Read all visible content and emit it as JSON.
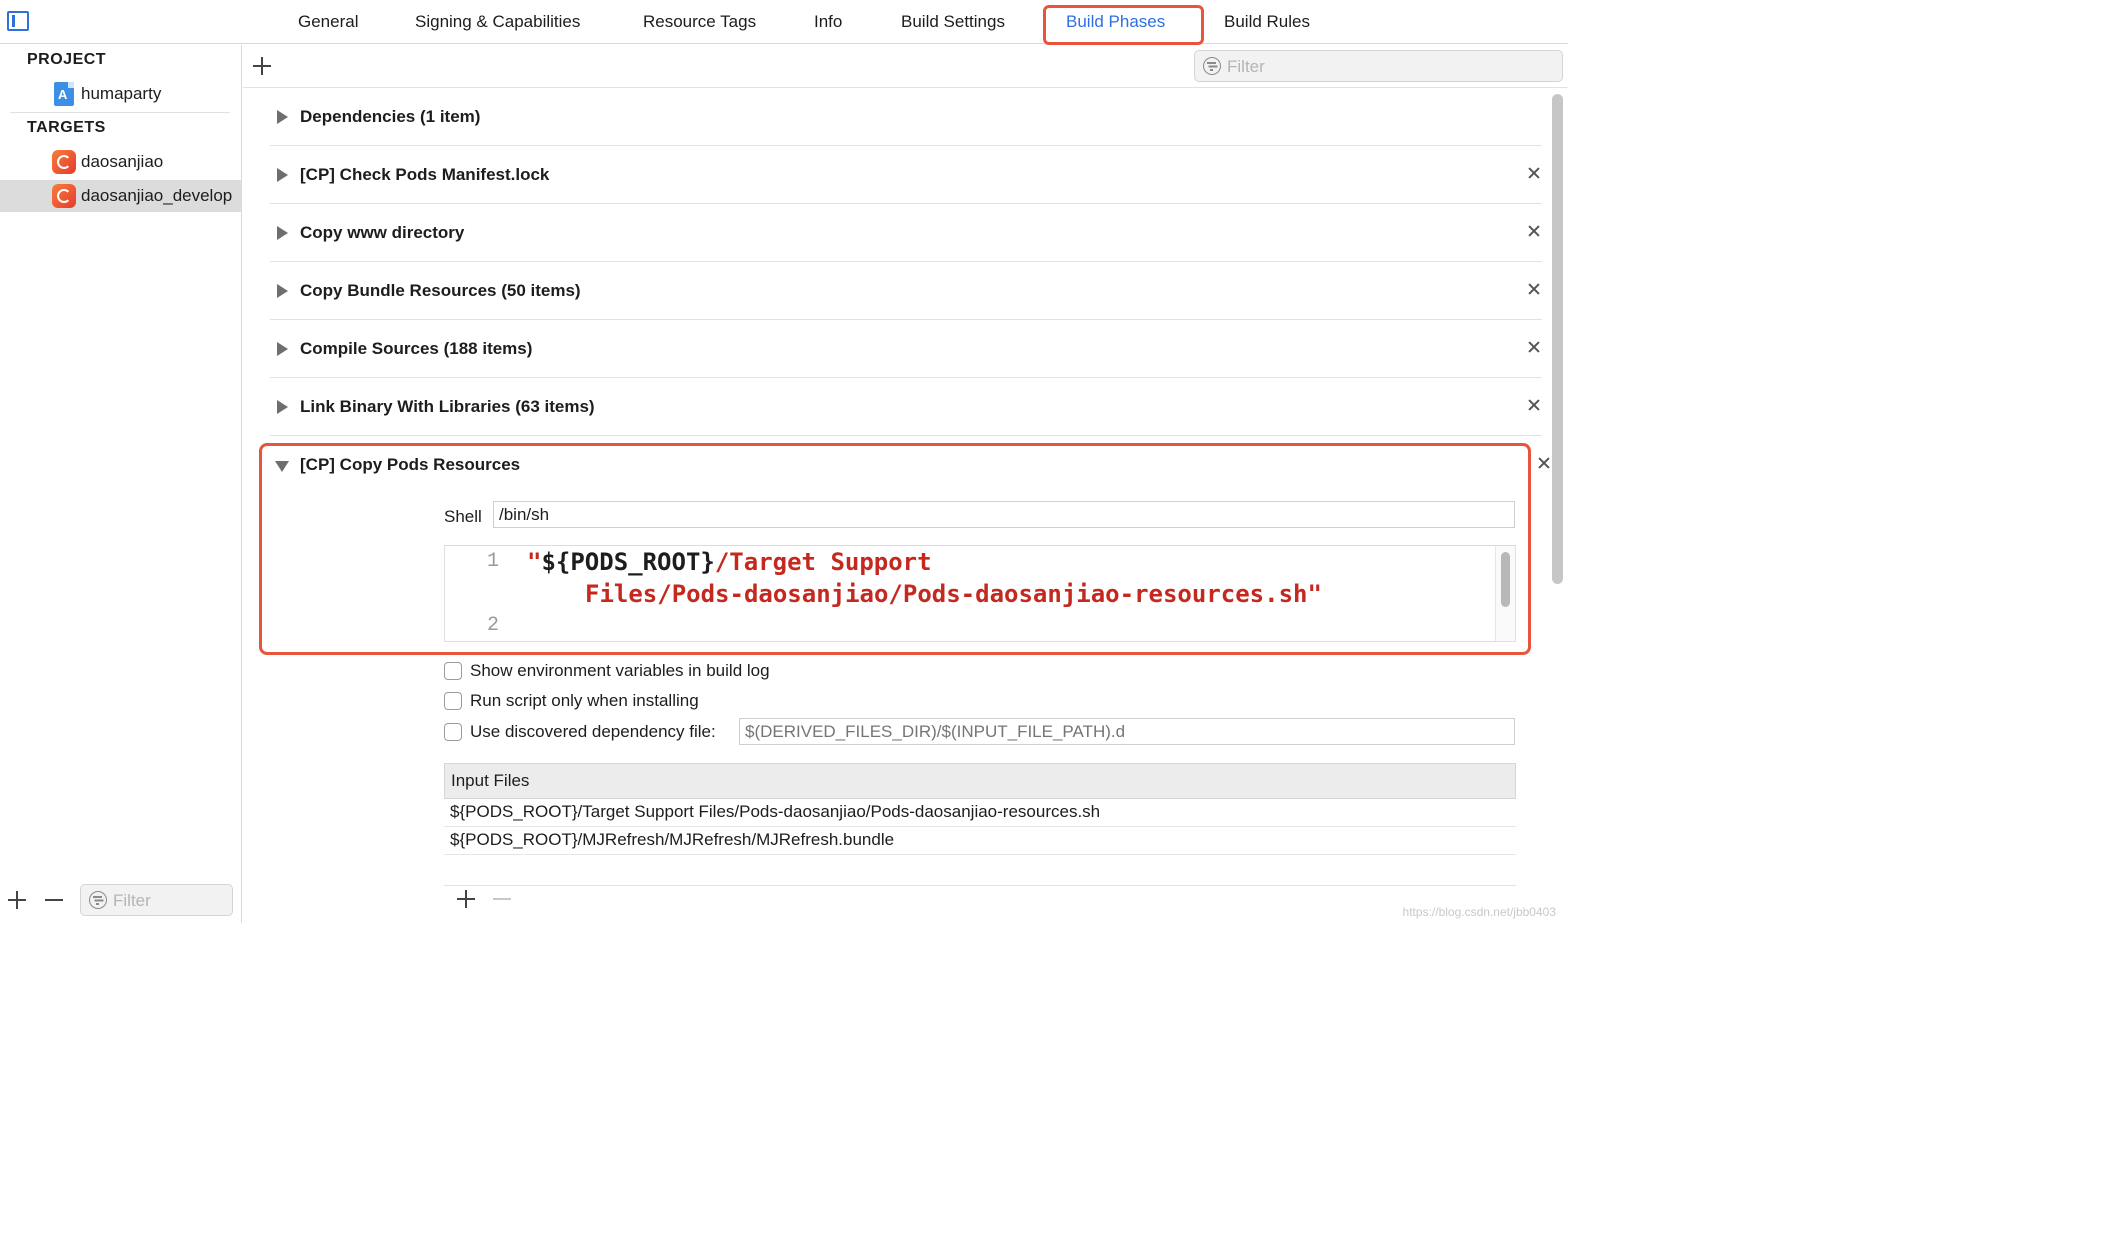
{
  "tabs": [
    {
      "label": "General"
    },
    {
      "label": "Signing & Capabilities"
    },
    {
      "label": "Resource Tags"
    },
    {
      "label": "Info"
    },
    {
      "label": "Build Settings"
    },
    {
      "label": "Build Phases",
      "active": true
    },
    {
      "label": "Build Rules"
    }
  ],
  "sidebar": {
    "project_header": "PROJECT",
    "project_item": "humaparty",
    "targets_header": "TARGETS",
    "targets": [
      {
        "label": "daosanjiao"
      },
      {
        "label": "daosanjiao_develop",
        "selected": true
      }
    ],
    "filter_placeholder": "Filter"
  },
  "toolbar": {
    "filter_placeholder": "Filter"
  },
  "phases": [
    {
      "title": "Dependencies (1 item)"
    },
    {
      "title": "[CP] Check Pods Manifest.lock"
    },
    {
      "title": "Copy www directory"
    },
    {
      "title": "Copy Bundle Resources (50 items)"
    },
    {
      "title": "Compile Sources (188 items)"
    },
    {
      "title": "Link Binary With Libraries (63 items)"
    },
    {
      "title": "[CP] Copy Pods Resources",
      "expanded": true
    }
  ],
  "script": {
    "shell_label": "Shell",
    "shell_value": "/bin/sh",
    "line_numbers": [
      "1",
      "2"
    ],
    "code_quote_open": "\"",
    "code_var": "${PODS_ROOT}",
    "code_path_1": "/Target Support",
    "code_path_2": "Files/Pods-daosanjiao/Pods-daosanjiao-resources.sh",
    "code_quote_close": "\""
  },
  "options": {
    "show_env": "Show environment variables in build log",
    "run_only_installing": "Run script only when installing",
    "use_dependency_file": "Use discovered dependency file:",
    "dependency_file_placeholder": "$(DERIVED_FILES_DIR)/$(INPUT_FILE_PATH).d"
  },
  "input_files": {
    "header": "Input Files",
    "rows": [
      "${PODS_ROOT}/Target Support Files/Pods-daosanjiao/Pods-daosanjiao-resources.sh",
      "${PODS_ROOT}/MJRefresh/MJRefresh/MJRefresh.bundle"
    ]
  },
  "watermark": "https://blog.csdn.net/jbb0403",
  "colors": {
    "accent": "#2f6fe0",
    "highlight": "#e8553a",
    "code_string": "#c4281e"
  }
}
